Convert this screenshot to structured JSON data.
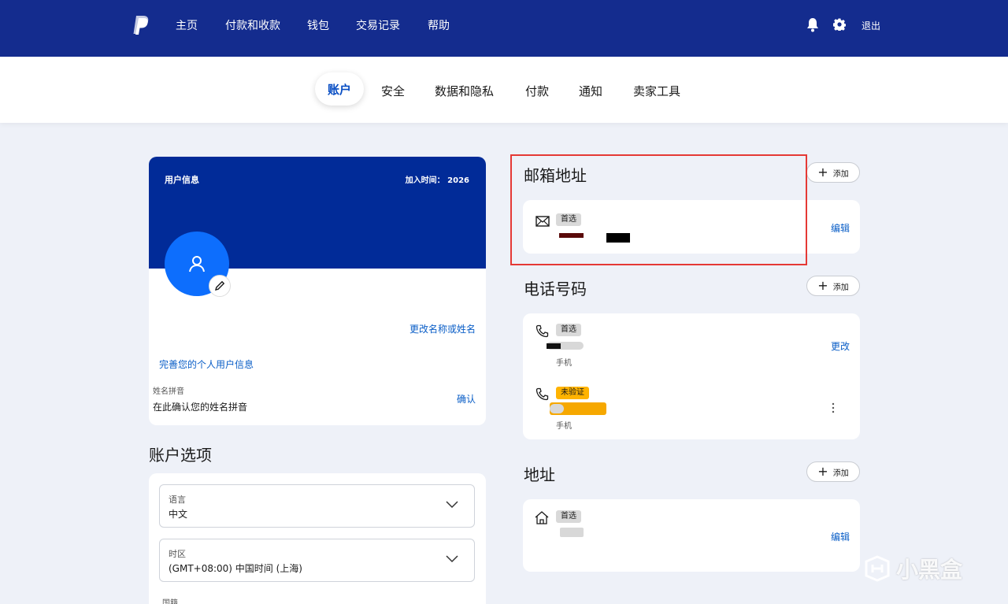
{
  "topnav": {
    "items": [
      "主页",
      "付款和收款",
      "钱包",
      "交易记录",
      "帮助"
    ],
    "logout": "退出",
    "icons": [
      "bell-icon",
      "gear-icon"
    ]
  },
  "tabs": {
    "active": "账户",
    "items": [
      "安全",
      "数据和隐私",
      "付款",
      "通知",
      "卖家工具"
    ]
  },
  "user_info": {
    "title": "用户信息",
    "join": "加入时间： 2026",
    "change_name": "更改名称或姓名",
    "complete_info": "完善您的个人用户信息",
    "pinyin_label": "姓名拼音",
    "pinyin_value": "在此确认您的姓名拼音",
    "confirm": "确认"
  },
  "account_options": {
    "title": "账户选项",
    "language_label": "语言",
    "language_value": "中文",
    "timezone_label": "时区",
    "timezone_value": "(GMT+08:00) 中国时间 (上海)",
    "nationality_label": "国籍"
  },
  "email": {
    "title": "邮箱地址",
    "add": "添加",
    "badge": "首选",
    "edit": "编辑"
  },
  "phone": {
    "title": "电话号码",
    "add": "添加",
    "items": [
      {
        "badge": "首选",
        "type": "手机",
        "action": "更改"
      },
      {
        "badge": "未验证",
        "type": "手机"
      }
    ]
  },
  "address": {
    "title": "地址",
    "add": "添加",
    "badge": "首选",
    "edit": "编辑"
  },
  "watermark": "小黑盒",
  "colors": {
    "topbar": "#142c8e",
    "banner": "#012b98",
    "link": "#0a5ec7",
    "highlight": "#e53935",
    "warn": "#ffb300"
  }
}
